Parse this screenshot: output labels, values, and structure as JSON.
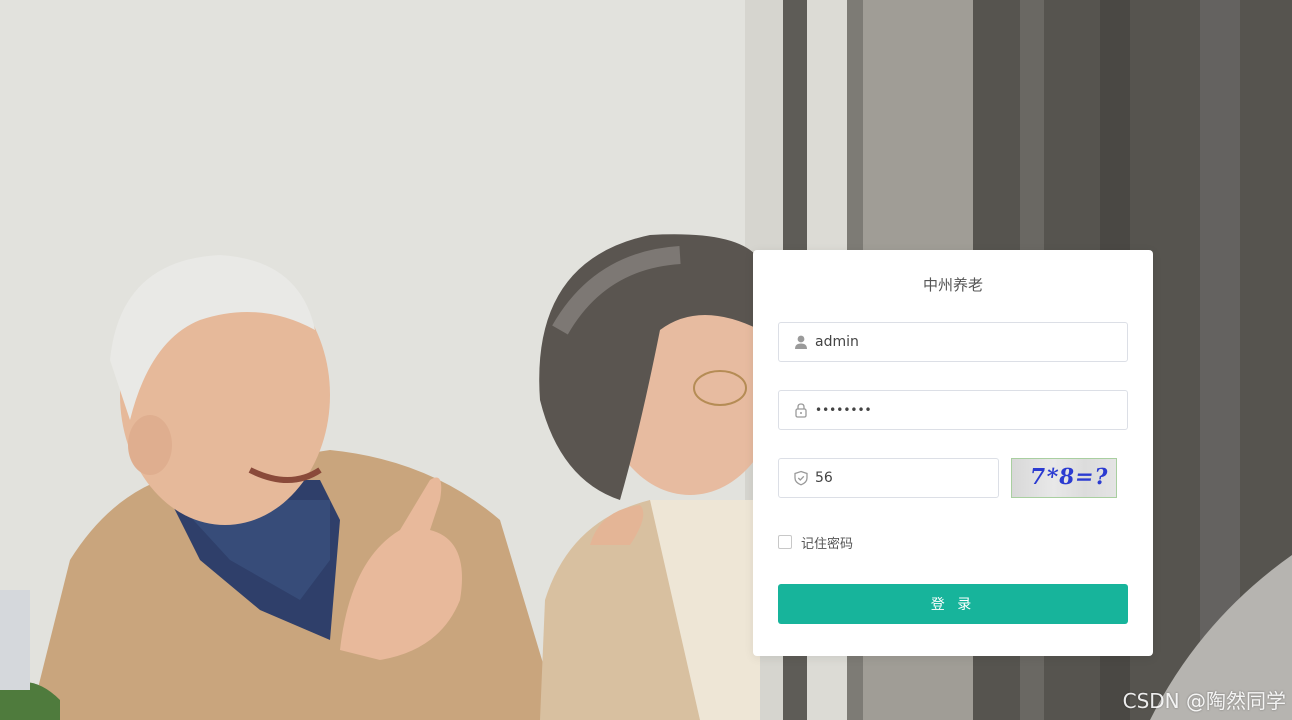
{
  "app": {
    "title": "中州养老"
  },
  "form": {
    "username": {
      "value": "admin",
      "icon": "user-icon"
    },
    "password": {
      "value": "••••••••",
      "icon": "lock-icon"
    },
    "captcha": {
      "value": "56",
      "icon": "shield-icon",
      "image_text": "7*8=?"
    },
    "remember_label": "记住密码",
    "remember_checked": false,
    "login_label": "登 录"
  },
  "watermark": "CSDN @陶然同学",
  "colors": {
    "primary": "#17b49b",
    "card_bg": "#ffffff",
    "input_border": "#dcdfe6",
    "captcha_text": "#2b3bd1"
  }
}
